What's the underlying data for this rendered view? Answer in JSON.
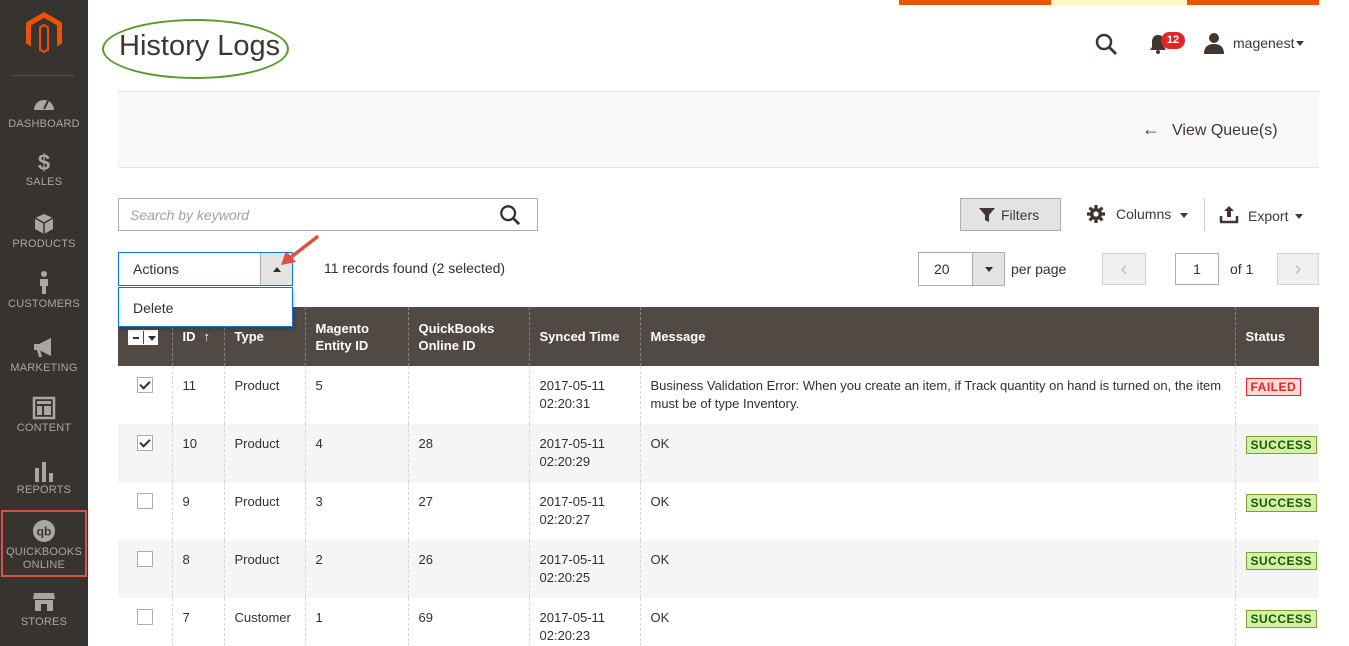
{
  "sidebar": {
    "items": [
      {
        "label": "DASHBOARD",
        "icon": "dashboard-icon"
      },
      {
        "label": "SALES",
        "icon": "dollar-icon"
      },
      {
        "label": "PRODUCTS",
        "icon": "box-icon"
      },
      {
        "label": "CUSTOMERS",
        "icon": "person-icon"
      },
      {
        "label": "MARKETING",
        "icon": "megaphone-icon"
      },
      {
        "label": "CONTENT",
        "icon": "layout-icon"
      },
      {
        "label": "REPORTS",
        "icon": "bar-chart-icon"
      },
      {
        "label": "QUICKBOOKS ONLINE",
        "icon": "quickbooks-icon"
      },
      {
        "label": "STORES",
        "icon": "store-icon"
      }
    ]
  },
  "header": {
    "title": "History Logs",
    "notification_count": "12",
    "username": "magenest"
  },
  "page_actions": {
    "view_queue": "View Queue(s)"
  },
  "toolbar": {
    "search_placeholder": "Search by keyword",
    "filters": "Filters",
    "columns": "Columns",
    "export": "Export",
    "actions_label": "Actions",
    "actions_menu": [
      "Delete"
    ],
    "records_text": "11 records found (2 selected)",
    "per_page_value": "20",
    "per_page_label": "per page",
    "current_page": "1",
    "page_of": "of 1"
  },
  "table": {
    "columns": [
      "ID",
      "Type",
      "Magento Entity ID",
      "QuickBooks Online ID",
      "Synced Time",
      "Message",
      "Status"
    ],
    "rows": [
      {
        "checked": true,
        "id": "11",
        "type": "Product",
        "entity_id": "5",
        "qbo_id": "",
        "synced_date": "2017-05-11",
        "synced_time": "02:20:31",
        "message": "Business Validation Error: When you create an item, if Track quantity on hand is turned on, the item must be of type Inventory.",
        "status": "FAILED"
      },
      {
        "checked": true,
        "id": "10",
        "type": "Product",
        "entity_id": "4",
        "qbo_id": "28",
        "synced_date": "2017-05-11",
        "synced_time": "02:20:29",
        "message": "OK",
        "status": "SUCCESS"
      },
      {
        "checked": false,
        "id": "9",
        "type": "Product",
        "entity_id": "3",
        "qbo_id": "27",
        "synced_date": "2017-05-11",
        "synced_time": "02:20:27",
        "message": "OK",
        "status": "SUCCESS"
      },
      {
        "checked": false,
        "id": "8",
        "type": "Product",
        "entity_id": "2",
        "qbo_id": "26",
        "synced_date": "2017-05-11",
        "synced_time": "02:20:25",
        "message": "OK",
        "status": "SUCCESS"
      },
      {
        "checked": false,
        "id": "7",
        "type": "Customer",
        "entity_id": "1",
        "qbo_id": "69",
        "synced_date": "2017-05-11",
        "synced_time": "02:20:23",
        "message": "OK",
        "status": "SUCCESS"
      }
    ]
  },
  "colors": {
    "sidebar_bg": "#373330",
    "logo_orange": "#eb5202",
    "table_header_bg": "#514943",
    "failed": "#e22626",
    "success": "#79a22e",
    "highlight_ellipse": "#5a9a2a",
    "highlight_box": "#e04f3f"
  }
}
